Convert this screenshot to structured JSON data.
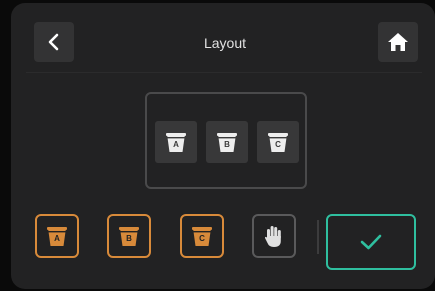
{
  "header": {
    "title": "Layout",
    "back_icon": "chevron-left-icon",
    "home_icon": "home-icon"
  },
  "layout_preview": {
    "slots": [
      {
        "letter": "A",
        "icon": "bucket-icon"
      },
      {
        "letter": "B",
        "icon": "bucket-icon"
      },
      {
        "letter": "C",
        "icon": "bucket-icon"
      }
    ]
  },
  "selectors": [
    {
      "letter": "A",
      "icon": "bucket-icon"
    },
    {
      "letter": "B",
      "icon": "bucket-icon"
    },
    {
      "letter": "C",
      "icon": "bucket-icon"
    }
  ],
  "manual_button": {
    "icon": "hand-icon"
  },
  "confirm_button": {
    "icon": "checkmark-icon"
  },
  "colors": {
    "panel": "#222223",
    "accent_orange": "#d88a3a",
    "accent_teal": "#2fbf9f",
    "slot_bg": "#383839"
  }
}
